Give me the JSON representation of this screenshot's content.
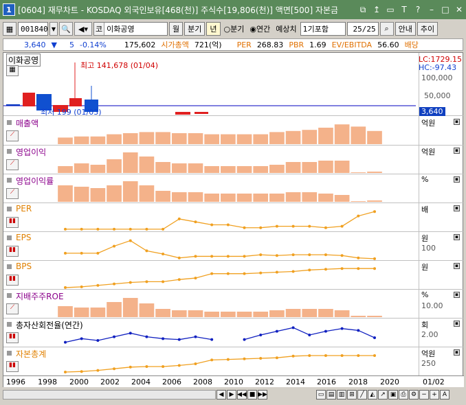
{
  "window": {
    "number": "1",
    "title": "[0604] 재무차트 - KOSDAQ 외국인보유[468(천)] 주식수[19,806(천)] 액면[500] 자본금"
  },
  "toolbar": {
    "code": "001840",
    "market_prefix": "코",
    "stock_name": "이화공영",
    "monthly": "월",
    "quarterly": "분기",
    "yearly": "년",
    "radio_quarter": "분기",
    "radio_year": "연간",
    "estimate_label": "예상치",
    "estimate_value": "1기포함",
    "page": "25/25",
    "guide": "안내",
    "add": "추이"
  },
  "quote": {
    "price": "3,640",
    "change": "5",
    "change_pct": "-0.14%",
    "volume": "175,602",
    "mktcap_label": "시가총액",
    "mktcap_value": "721(억)",
    "per_label": "PER",
    "per_value": "268.83",
    "pbr_label": "PBR",
    "pbr_value": "1.69",
    "ev_label": "EV/EBITDA",
    "ev_value": "56.60",
    "div_label": "배당"
  },
  "price_panel": {
    "name": "이화공영",
    "high_note": "최고 141,678 (01/04)",
    "low_note": "최저 199 (01/03)",
    "lc": "LC:1729.15",
    "hc": "HC:-97.43",
    "axis_top": "100,000",
    "axis_mid": "50,000",
    "current": "3,640"
  },
  "panels": [
    {
      "label": "매출액",
      "unit": "억원",
      "tick": "",
      "color": "#8b008b"
    },
    {
      "label": "영업이익",
      "unit": "억원",
      "tick": "",
      "color": "#8b008b"
    },
    {
      "label": "영업이익률",
      "unit": "%",
      "tick": "",
      "color": "#8b008b"
    },
    {
      "label": "PER",
      "unit": "배",
      "tick": "",
      "color": "#e08000"
    },
    {
      "label": "EPS",
      "unit": "원",
      "tick": "100",
      "color": "#e08000"
    },
    {
      "label": "BPS",
      "unit": "원",
      "tick": "",
      "color": "#e08000"
    },
    {
      "label": "지배주주ROE",
      "unit": "%",
      "tick": "10.00",
      "color": "#8b008b"
    },
    {
      "label": "총자산회전율(연간)",
      "unit": "회",
      "tick": "2.00",
      "color": "#000000"
    },
    {
      "label": "자본총계",
      "unit": "억원",
      "tick": "250",
      "color": "#e08000"
    }
  ],
  "x_axis": [
    "1996",
    "1998",
    "2000",
    "2002",
    "2004",
    "2006",
    "2008",
    "2010",
    "2012",
    "2014",
    "2016",
    "2018",
    "2020"
  ],
  "x_axis_right": "01/02",
  "chart_data": [
    {
      "type": "bar",
      "title": "매출액",
      "categories": [
        "2000",
        "2001",
        "2002",
        "2003",
        "2004",
        "2005",
        "2006",
        "2007",
        "2008",
        "2009",
        "2010",
        "2011",
        "2012",
        "2013",
        "2014",
        "2015",
        "2016",
        "2017",
        "2018",
        "2019"
      ],
      "values": [
        6,
        7,
        7,
        9,
        10,
        11,
        11,
        10,
        10,
        9,
        9,
        9,
        9,
        11,
        12,
        13,
        15,
        18,
        16,
        12
      ],
      "ylim": [
        0,
        20
      ]
    },
    {
      "type": "bar",
      "title": "영업이익",
      "categories": [
        "2000",
        "2001",
        "2002",
        "2003",
        "2004",
        "2005",
        "2006",
        "2007",
        "2008",
        "2009",
        "2010",
        "2011",
        "2012",
        "2013",
        "2014",
        "2015",
        "2016",
        "2017",
        "2018",
        "2019"
      ],
      "values": [
        5,
        7,
        6,
        10,
        15,
        12,
        8,
        7,
        7,
        5,
        5,
        5,
        5,
        6,
        8,
        8,
        9,
        9,
        0.5,
        1
      ],
      "ylim": [
        0,
        16
      ]
    },
    {
      "type": "bar",
      "title": "영업이익률",
      "categories": [
        "2000",
        "2001",
        "2002",
        "2003",
        "2004",
        "2005",
        "2006",
        "2007",
        "2008",
        "2009",
        "2010",
        "2011",
        "2012",
        "2013",
        "2014",
        "2015",
        "2016",
        "2017",
        "2018",
        "2019"
      ],
      "values": [
        12,
        11,
        10,
        12,
        15,
        12,
        8,
        7,
        7,
        6,
        6,
        6,
        6,
        6,
        7,
        7,
        6,
        5,
        0.5,
        1
      ],
      "ylim": [
        0,
        16
      ]
    },
    {
      "type": "line",
      "title": "PER",
      "x": [
        "2000",
        "2001",
        "2002",
        "2003",
        "2004",
        "2005",
        "2006",
        "2007",
        "2008",
        "2009",
        "2010",
        "2011",
        "2012",
        "2013",
        "2014",
        "2015",
        "2016",
        "2017",
        "2018",
        "2019"
      ],
      "values": [
        1,
        1,
        1,
        1,
        1,
        1,
        1,
        8,
        6,
        4,
        4,
        2,
        2,
        3,
        3,
        3,
        2,
        3,
        10,
        13
      ],
      "ylim": [
        0,
        15
      ]
    },
    {
      "type": "line",
      "title": "EPS",
      "x": [
        "2000",
        "2001",
        "2002",
        "2003",
        "2004",
        "2005",
        "2006",
        "2007",
        "2008",
        "2009",
        "2010",
        "2011",
        "2012",
        "2013",
        "2014",
        "2015",
        "2016",
        "2017",
        "2018",
        "2019"
      ],
      "values": [
        40,
        40,
        40,
        85,
        120,
        55,
        35,
        10,
        20,
        20,
        20,
        20,
        30,
        25,
        30,
        30,
        30,
        25,
        10,
        5
      ],
      "ylim": [
        0,
        140
      ]
    },
    {
      "type": "line",
      "title": "BPS",
      "x": [
        "2000",
        "2001",
        "2002",
        "2003",
        "2004",
        "2005",
        "2006",
        "2007",
        "2008",
        "2009",
        "2010",
        "2011",
        "2012",
        "2013",
        "2014",
        "2015",
        "2016",
        "2017",
        "2018",
        "2019"
      ],
      "values": [
        1,
        2,
        4,
        6,
        8,
        9,
        9,
        12,
        14,
        20,
        20,
        20,
        21,
        22,
        23,
        25,
        26,
        27,
        27,
        27
      ],
      "ylim": [
        0,
        30
      ]
    },
    {
      "type": "bar",
      "title": "지배주주ROE",
      "categories": [
        "2000",
        "2001",
        "2002",
        "2003",
        "2004",
        "2005",
        "2006",
        "2007",
        "2008",
        "2009",
        "2010",
        "2011",
        "2012",
        "2013",
        "2014",
        "2015",
        "2016",
        "2017",
        "2018",
        "2019"
      ],
      "values": [
        8,
        7,
        7,
        11,
        14,
        10,
        6,
        5,
        5,
        4,
        4,
        4,
        4,
        5,
        6,
        6,
        6,
        5,
        1,
        1
      ],
      "ylim": [
        0,
        16
      ]
    },
    {
      "type": "line",
      "title": "총자산회전율(연간)",
      "x": [
        "2000",
        "2001",
        "2002",
        "2003",
        "2004",
        "2005",
        "2006",
        "2007",
        "2008",
        "2009",
        "2010",
        "2011",
        "2012",
        "2013",
        "2014",
        "2015",
        "2016",
        "2017",
        "2018",
        "2019"
      ],
      "values": [
        1.2,
        1.6,
        1.4,
        1.8,
        2.2,
        1.8,
        1.6,
        1.5,
        1.8,
        1.5,
        null,
        1.5,
        2.0,
        2.4,
        2.8,
        2.0,
        2.4,
        2.7,
        2.5,
        1.7
      ],
      "ylim": [
        0.8,
        3.2
      ]
    },
    {
      "type": "line",
      "title": "자본총계",
      "x": [
        "2000",
        "2001",
        "2002",
        "2003",
        "2004",
        "2005",
        "2006",
        "2007",
        "2008",
        "2009",
        "2010",
        "2011",
        "2012",
        "2013",
        "2014",
        "2015",
        "2016",
        "2017",
        "2018",
        "2019"
      ],
      "values": [
        100,
        110,
        130,
        160,
        190,
        200,
        200,
        220,
        250,
        320,
        330,
        340,
        350,
        360,
        390,
        400,
        400,
        400,
        400,
        400
      ],
      "ylim": [
        50,
        450
      ]
    }
  ]
}
